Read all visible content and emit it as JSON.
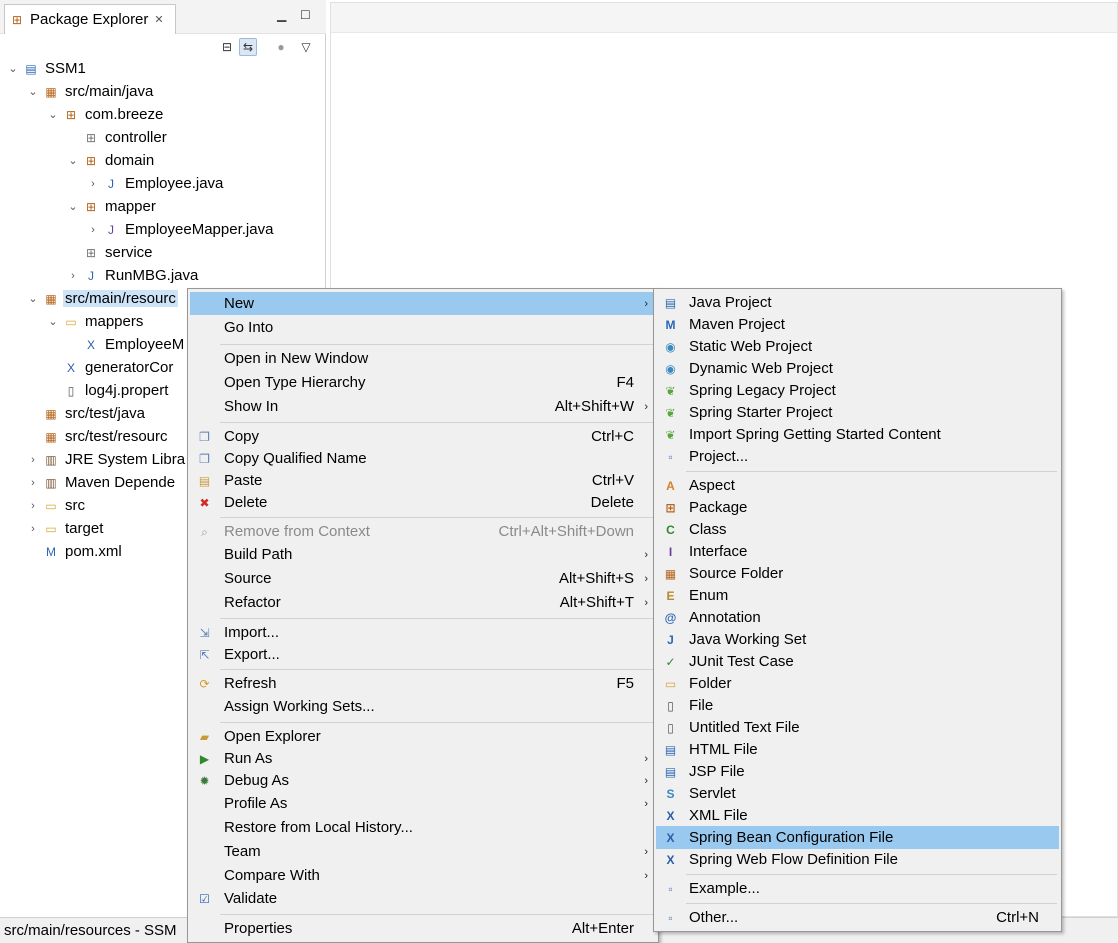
{
  "package_explorer": {
    "tab_label": "Package Explorer",
    "tree": [
      {
        "label": "SSM1",
        "twisty": "open",
        "icon": "project-icon",
        "glyph": "▤"
      },
      {
        "label": "src/main/java",
        "twisty": "open",
        "icon": "source-folder-icon",
        "glyph": "▦"
      },
      {
        "label": "com.breeze",
        "twisty": "open",
        "icon": "package-icon",
        "glyph": "⊞"
      },
      {
        "label": "controller",
        "twisty": "",
        "icon": "package-empty-icon",
        "glyph": "⊞"
      },
      {
        "label": "domain",
        "twisty": "open",
        "icon": "package-icon",
        "glyph": "⊞"
      },
      {
        "label": "Employee.java",
        "twisty": "closed",
        "icon": "java-file-icon",
        "glyph": "J"
      },
      {
        "label": "mapper",
        "twisty": "open",
        "icon": "package-icon",
        "glyph": "⊞"
      },
      {
        "label": "EmployeeMapper.java",
        "twisty": "closed",
        "icon": "java-interface-file-icon",
        "glyph": "J"
      },
      {
        "label": "service",
        "twisty": "",
        "icon": "package-empty-icon",
        "glyph": "⊞"
      },
      {
        "label": "RunMBG.java",
        "twisty": "closed",
        "icon": "java-file-icon",
        "glyph": "J"
      },
      {
        "label": "src/main/resourc",
        "twisty": "open",
        "icon": "source-folder-icon",
        "glyph": "▦"
      },
      {
        "label": "mappers",
        "twisty": "open",
        "icon": "folder-icon",
        "glyph": "▭"
      },
      {
        "label": "EmployeeM",
        "twisty": "",
        "icon": "xml-file-icon",
        "glyph": "X"
      },
      {
        "label": "generatorCor",
        "twisty": "",
        "icon": "xml-file-icon",
        "glyph": "X"
      },
      {
        "label": "log4j.propert",
        "twisty": "",
        "icon": "properties-file-icon",
        "glyph": "▯"
      },
      {
        "label": "src/test/java",
        "twisty": "",
        "icon": "source-folder-icon",
        "glyph": "▦"
      },
      {
        "label": "src/test/resourc",
        "twisty": "",
        "icon": "source-folder-icon",
        "glyph": "▦"
      },
      {
        "label": "JRE System Libra",
        "twisty": "closed",
        "icon": "library-icon",
        "glyph": "▥"
      },
      {
        "label": "Maven Depende",
        "twisty": "closed",
        "icon": "library-icon",
        "glyph": "▥"
      },
      {
        "label": "src",
        "twisty": "closed",
        "icon": "folder-icon",
        "glyph": "▭"
      },
      {
        "label": "target",
        "twisty": "closed",
        "icon": "folder-icon",
        "glyph": "▭"
      },
      {
        "label": "pom.xml",
        "twisty": "",
        "icon": "maven-pom-icon",
        "glyph": "M"
      }
    ]
  },
  "status_bar": {
    "text": "src/main/resources - SSM"
  },
  "context_menu": {
    "items": [
      {
        "label": "New",
        "shortcut": "",
        "submenu": true,
        "icon": "",
        "glyph": "",
        "highlight": true
      },
      {
        "label": "Go Into",
        "shortcut": "",
        "submenu": false,
        "icon": "",
        "glyph": ""
      },
      {
        "label": "Open in New Window",
        "shortcut": "",
        "submenu": false,
        "icon": "",
        "glyph": ""
      },
      {
        "label": "Open Type Hierarchy",
        "shortcut": "F4",
        "submenu": false,
        "icon": "",
        "glyph": ""
      },
      {
        "label": "Show In",
        "shortcut": "Alt+Shift+W",
        "submenu": true,
        "icon": "",
        "glyph": ""
      },
      {
        "label": "Copy",
        "shortcut": "Ctrl+C",
        "submenu": false,
        "icon": "copy-icon",
        "glyph": "❐"
      },
      {
        "label": "Copy Qualified Name",
        "shortcut": "",
        "submenu": false,
        "icon": "copy-qualified-name-icon",
        "glyph": "❐"
      },
      {
        "label": "Paste",
        "shortcut": "Ctrl+V",
        "submenu": false,
        "icon": "paste-icon",
        "glyph": "▤"
      },
      {
        "label": "Delete",
        "shortcut": "Delete",
        "submenu": false,
        "icon": "delete-icon",
        "glyph": "✖"
      },
      {
        "label": "Remove from Context",
        "shortcut": "Ctrl+Alt+Shift+Down",
        "submenu": false,
        "icon": "remove-from-context-icon",
        "glyph": "⌕",
        "disabled": true
      },
      {
        "label": "Build Path",
        "shortcut": "",
        "submenu": true,
        "icon": "",
        "glyph": ""
      },
      {
        "label": "Source",
        "shortcut": "Alt+Shift+S",
        "submenu": true,
        "icon": "",
        "glyph": ""
      },
      {
        "label": "Refactor",
        "shortcut": "Alt+Shift+T",
        "submenu": true,
        "icon": "",
        "glyph": ""
      },
      {
        "label": "Import...",
        "shortcut": "",
        "submenu": false,
        "icon": "import-icon",
        "glyph": "⇲"
      },
      {
        "label": "Export...",
        "shortcut": "",
        "submenu": false,
        "icon": "export-icon",
        "glyph": "⇱"
      },
      {
        "label": "Refresh",
        "shortcut": "F5",
        "submenu": false,
        "icon": "refresh-icon",
        "glyph": "⟳"
      },
      {
        "label": "Assign Working Sets...",
        "shortcut": "",
        "submenu": false,
        "icon": "",
        "glyph": ""
      },
      {
        "label": "Open Explorer",
        "shortcut": "",
        "submenu": false,
        "icon": "open-explorer-icon",
        "glyph": "▰"
      },
      {
        "label": "Run As",
        "shortcut": "",
        "submenu": true,
        "icon": "run-icon",
        "glyph": "▶"
      },
      {
        "label": "Debug As",
        "shortcut": "",
        "submenu": true,
        "icon": "debug-icon",
        "glyph": "✹"
      },
      {
        "label": "Profile As",
        "shortcut": "",
        "submenu": true,
        "icon": "",
        "glyph": ""
      },
      {
        "label": "Restore from Local History...",
        "shortcut": "",
        "submenu": false,
        "icon": "",
        "glyph": ""
      },
      {
        "label": "Team",
        "shortcut": "",
        "submenu": true,
        "icon": "",
        "glyph": ""
      },
      {
        "label": "Compare With",
        "shortcut": "",
        "submenu": true,
        "icon": "",
        "glyph": ""
      },
      {
        "label": "Validate",
        "shortcut": "",
        "submenu": false,
        "icon": "validate-check-icon",
        "glyph": "☑"
      },
      {
        "label": "Properties",
        "shortcut": "Alt+Enter",
        "submenu": false,
        "icon": "",
        "glyph": ""
      }
    ]
  },
  "new_submenu": {
    "items": [
      {
        "label": "Java Project",
        "icon": "java-project-icon",
        "glyph": "▤"
      },
      {
        "label": "Maven Project",
        "icon": "maven-project-icon",
        "glyph": "M"
      },
      {
        "label": "Static Web Project",
        "icon": "static-web-project-icon",
        "glyph": "◉"
      },
      {
        "label": "Dynamic Web Project",
        "icon": "dynamic-web-project-icon",
        "glyph": "◉"
      },
      {
        "label": "Spring Legacy Project",
        "icon": "spring-legacy-project-icon",
        "glyph": "❦"
      },
      {
        "label": "Spring Starter Project",
        "icon": "spring-starter-project-icon",
        "glyph": "❦"
      },
      {
        "label": "Import Spring Getting Started Content",
        "icon": "spring-import-icon",
        "glyph": "❦"
      },
      {
        "label": "Project...",
        "icon": "project-wizard-icon",
        "glyph": "▫"
      },
      {
        "label": "Aspect",
        "icon": "aspect-icon",
        "glyph": "A"
      },
      {
        "label": "Package",
        "icon": "package-icon",
        "glyph": "⊞"
      },
      {
        "label": "Class",
        "icon": "class-icon",
        "glyph": "C"
      },
      {
        "label": "Interface",
        "icon": "interface-icon",
        "glyph": "I"
      },
      {
        "label": "Source Folder",
        "icon": "source-folder-icon",
        "glyph": "▦"
      },
      {
        "label": "Enum",
        "icon": "enum-icon",
        "glyph": "E"
      },
      {
        "label": "Annotation",
        "icon": "annotation-icon",
        "glyph": "@"
      },
      {
        "label": "Java Working Set",
        "icon": "java-working-set-icon",
        "glyph": "J"
      },
      {
        "label": "JUnit Test Case",
        "icon": "junit-test-case-icon",
        "glyph": "✓"
      },
      {
        "label": "Folder",
        "icon": "folder-icon",
        "glyph": "▭"
      },
      {
        "label": "File",
        "icon": "file-icon",
        "glyph": "▯"
      },
      {
        "label": "Untitled Text File",
        "icon": "text-file-icon",
        "glyph": "▯"
      },
      {
        "label": "HTML File",
        "icon": "html-file-icon",
        "glyph": "▤"
      },
      {
        "label": "JSP File",
        "icon": "jsp-file-icon",
        "glyph": "▤"
      },
      {
        "label": "Servlet",
        "icon": "servlet-icon",
        "glyph": "S"
      },
      {
        "label": "XML File",
        "icon": "xml-file-icon",
        "glyph": "X"
      },
      {
        "label": "Spring Bean Configuration File",
        "icon": "spring-bean-config-icon",
        "glyph": "X",
        "highlight": true
      },
      {
        "label": "Spring Web Flow Definition File",
        "icon": "spring-web-flow-icon",
        "glyph": "X"
      },
      {
        "label": "Example...",
        "icon": "example-icon",
        "glyph": "▫"
      },
      {
        "label": "Other...",
        "icon": "other-wizard-icon",
        "glyph": "▫",
        "shortcut": "Ctrl+N"
      }
    ]
  }
}
